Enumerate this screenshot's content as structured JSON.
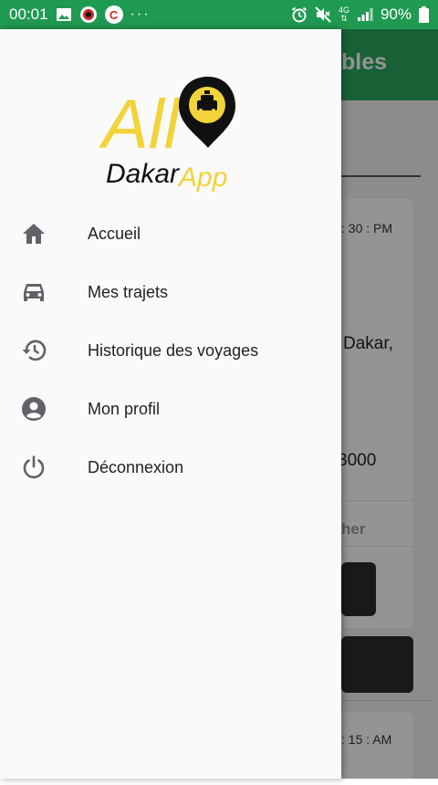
{
  "status_bar": {
    "time": "00:01",
    "c_icon_letter": "C",
    "more": "···",
    "network": "4G",
    "battery": "90%"
  },
  "app_background": {
    "title_fragment": "bles",
    "card1": {
      "time": ": 30 : PM",
      "address_fragment": "Dakar,",
      "price_fragment": "3000",
      "action_fragment": "her"
    },
    "card2": {
      "time": ": 15 : AM"
    }
  },
  "drawer": {
    "logo": {
      "word_all": "All",
      "word_dakar": "Dakar",
      "word_app": "App",
      "color_yellow": "#f2d33a",
      "color_black": "#111111"
    },
    "items": [
      {
        "label": "Accueil",
        "icon": "home-icon"
      },
      {
        "label": "Mes trajets",
        "icon": "car-icon"
      },
      {
        "label": "Historique des voyages",
        "icon": "history-icon"
      },
      {
        "label": "Mon profil",
        "icon": "account-icon"
      },
      {
        "label": "Déconnexion",
        "icon": "power-icon"
      }
    ]
  },
  "colors": {
    "status_bar": "#1f9a52",
    "app_header": "#2aa760",
    "drawer_bg": "#fafafa",
    "icon_gray": "#5f6368"
  }
}
